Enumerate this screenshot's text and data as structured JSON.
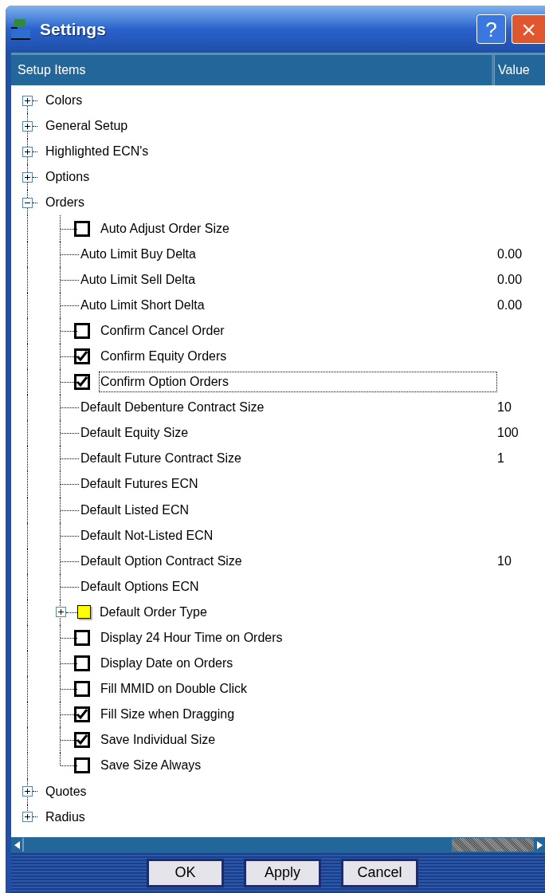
{
  "window": {
    "title": "Settings",
    "help_button": "?",
    "close_button": "×"
  },
  "table": {
    "columns": [
      "Setup Items",
      "Value"
    ]
  },
  "tree": [
    {
      "label": "Colors",
      "expanded": false
    },
    {
      "label": "General Setup",
      "expanded": false
    },
    {
      "label": "Highlighted ECN's",
      "expanded": false
    },
    {
      "label": "Options",
      "expanded": false
    },
    {
      "label": "Orders",
      "expanded": true,
      "children": [
        {
          "kind": "checkbox",
          "label": "Auto Adjust Order Size",
          "checked": false,
          "selected": false
        },
        {
          "kind": "value",
          "label": "Auto Limit Buy Delta",
          "value": "0.00",
          "selected": false
        },
        {
          "kind": "value",
          "label": "Auto Limit Sell Delta",
          "value": "0.00",
          "selected": false
        },
        {
          "kind": "value",
          "label": "Auto Limit Short Delta",
          "value": "0.00",
          "selected": false
        },
        {
          "kind": "checkbox",
          "label": "Confirm Cancel Order",
          "checked": false,
          "selected": false
        },
        {
          "kind": "checkbox",
          "label": "Confirm Equity Orders",
          "checked": true,
          "selected": false
        },
        {
          "kind": "checkbox",
          "label": "Confirm Option Orders",
          "checked": true,
          "selected": true
        },
        {
          "kind": "value",
          "label": "Default Debenture Contract Size",
          "value": "10",
          "selected": false
        },
        {
          "kind": "value",
          "label": "Default Equity Size",
          "value": "100",
          "selected": false
        },
        {
          "kind": "value",
          "label": "Default Future Contract Size",
          "value": "1",
          "selected": false
        },
        {
          "kind": "value",
          "label": "Default Futures ECN",
          "selected": false
        },
        {
          "kind": "value",
          "label": "Default Listed ECN",
          "selected": false
        },
        {
          "kind": "value",
          "label": "Default Not-Listed ECN",
          "selected": false
        },
        {
          "kind": "value",
          "label": "Default Option Contract Size",
          "value": "10",
          "selected": false
        },
        {
          "kind": "value",
          "label": "Default Options ECN",
          "selected": false
        },
        {
          "kind": "color",
          "label": "Default Order Type",
          "color": "#ffff00",
          "expanded": false,
          "selected": false
        },
        {
          "kind": "checkbox",
          "label": "Display 24 Hour Time on Orders",
          "checked": false,
          "selected": false
        },
        {
          "kind": "checkbox",
          "label": "Display Date on Orders",
          "checked": false,
          "selected": false
        },
        {
          "kind": "checkbox",
          "label": "Fill MMID on Double Click",
          "checked": false,
          "selected": false
        },
        {
          "kind": "checkbox",
          "label": "Fill Size when Dragging",
          "checked": true,
          "selected": false
        },
        {
          "kind": "checkbox",
          "label": "Save Individual Size",
          "checked": true,
          "selected": false
        },
        {
          "kind": "checkbox",
          "label": "Save Size Always",
          "checked": false,
          "selected": false
        }
      ]
    },
    {
      "label": "Quotes",
      "expanded": false
    },
    {
      "label": "Radius",
      "expanded": false
    }
  ],
  "buttons": [
    "OK",
    "Apply",
    "Cancel"
  ]
}
